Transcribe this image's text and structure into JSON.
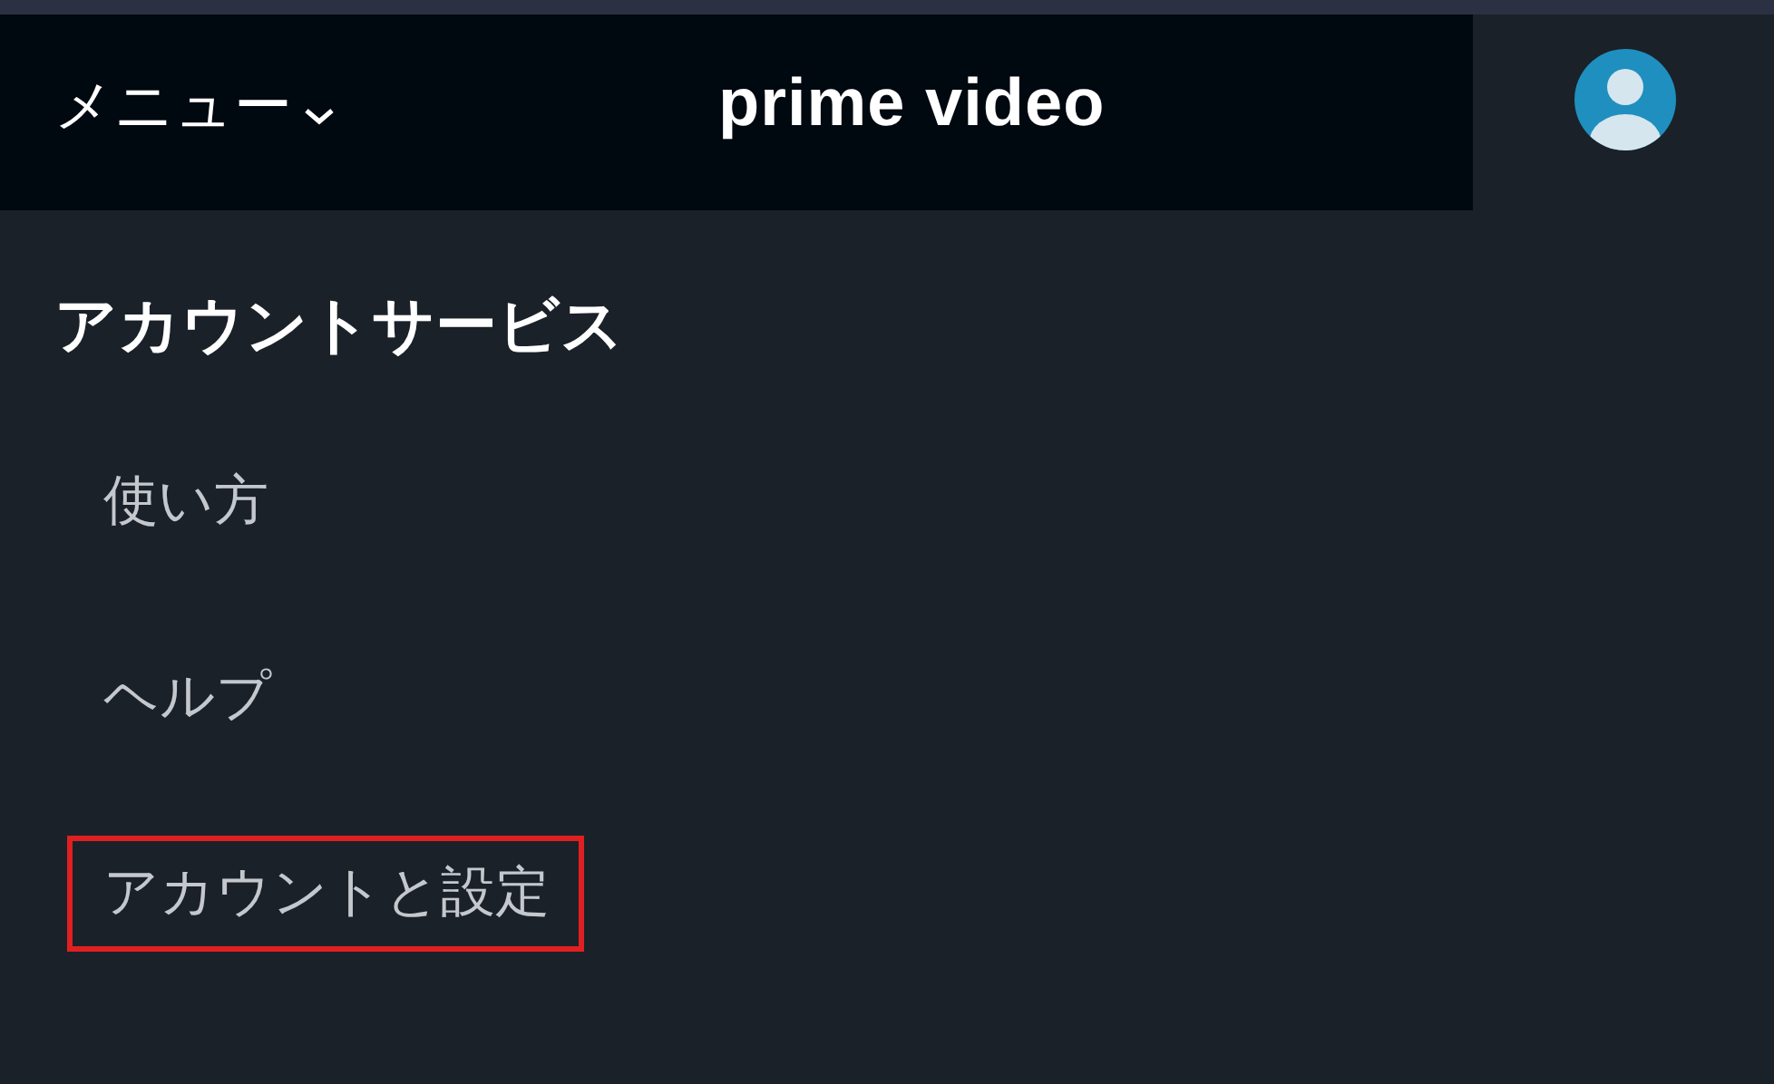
{
  "header": {
    "menu_label": "メニュー",
    "brand": "prime video"
  },
  "section_title": "アカウントサービス",
  "items": [
    {
      "label": "使い方",
      "highlighted": false
    },
    {
      "label": "ヘルプ",
      "highlighted": false
    },
    {
      "label": "アカウントと設定",
      "highlighted": true
    }
  ]
}
